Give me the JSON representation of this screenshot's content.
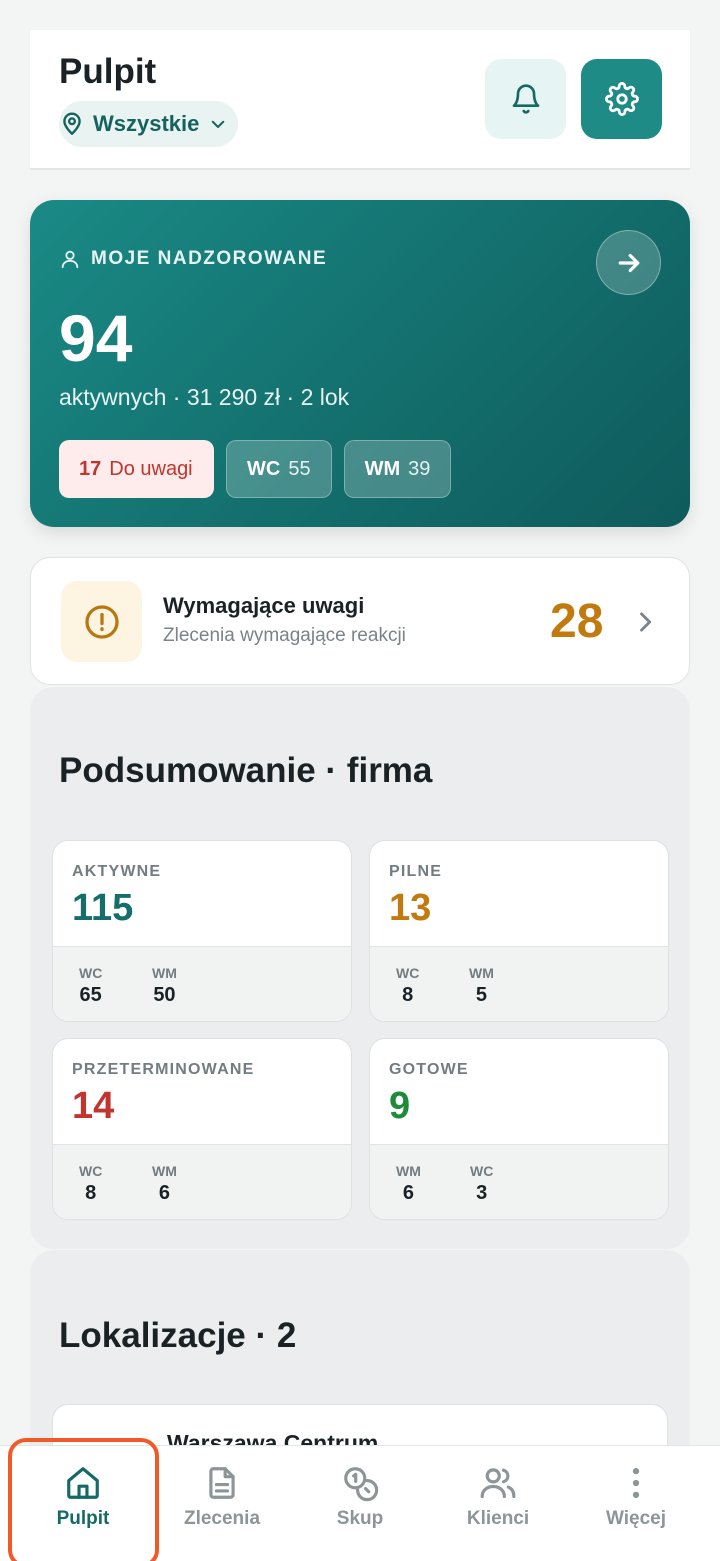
{
  "header": {
    "title": "Pulpit",
    "location_filter": "Wszystkie"
  },
  "hero": {
    "label": "MOJE NADZOROWANE",
    "count": "94",
    "subtitle": "aktywnych · 31 290 zł · 2 lok",
    "chips": [
      {
        "key": "17",
        "value": "Do uwagi"
      },
      {
        "key": "WC",
        "value": "55"
      },
      {
        "key": "WM",
        "value": "39"
      }
    ]
  },
  "attention": {
    "title": "Wymagające uwagi",
    "subtitle": "Zlecenia wymagające reakcji",
    "count": "28"
  },
  "summary": {
    "title": "Podsumowanie · firma",
    "cards": [
      {
        "label": "AKTYWNE",
        "value": "115",
        "color": "#156e6a",
        "breakdown": [
          {
            "k": "WC",
            "v": "65"
          },
          {
            "k": "WM",
            "v": "50"
          }
        ]
      },
      {
        "label": "PILNE",
        "value": "13",
        "color": "#c27a0e",
        "breakdown": [
          {
            "k": "WC",
            "v": "8"
          },
          {
            "k": "WM",
            "v": "5"
          }
        ]
      },
      {
        "label": "PRZETERMINOWANE",
        "value": "14",
        "color": "#c0352d",
        "breakdown": [
          {
            "k": "WC",
            "v": "8"
          },
          {
            "k": "WM",
            "v": "6"
          }
        ]
      },
      {
        "label": "GOTOWE",
        "value": "9",
        "color": "#1f8a3a",
        "breakdown": [
          {
            "k": "WM",
            "v": "6"
          },
          {
            "k": "WC",
            "v": "3"
          }
        ]
      }
    ]
  },
  "locations": {
    "title": "Lokalizacje · 2",
    "items": [
      {
        "name": "Warszawa Centrum"
      }
    ]
  },
  "tabbar": {
    "items": [
      {
        "label": "Pulpit",
        "icon": "home-icon",
        "active": true
      },
      {
        "label": "Zlecenia",
        "icon": "document-icon"
      },
      {
        "label": "Skup",
        "icon": "coins-icon"
      },
      {
        "label": "Klienci",
        "icon": "users-icon"
      },
      {
        "label": "Więcej",
        "icon": "more-vertical-icon"
      }
    ]
  },
  "colors": {
    "accent": "#1e8b86",
    "warning": "#c27a0e",
    "danger": "#c0352d",
    "success": "#1f8a3a",
    "highlight": "#f05a28"
  }
}
